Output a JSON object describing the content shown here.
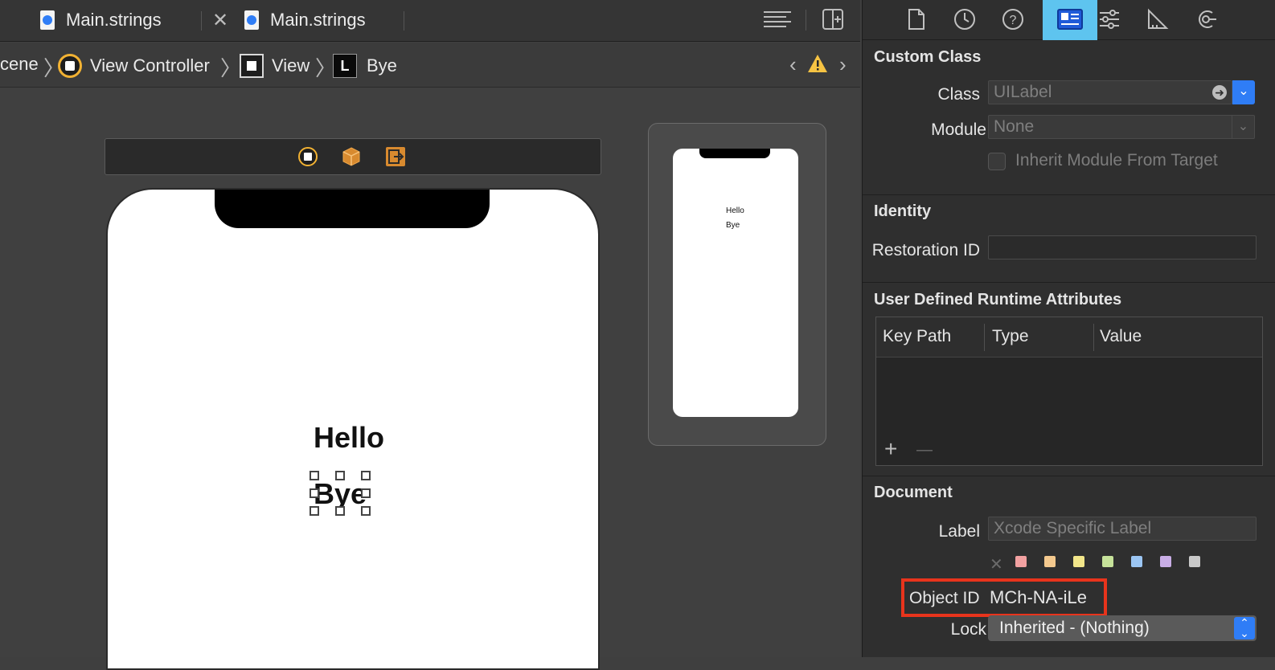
{
  "tabs": [
    {
      "label": "Main.strings",
      "close": ""
    },
    {
      "label": "Main.strings",
      "close": "✕"
    }
  ],
  "breadcrumb": {
    "items": [
      "cene",
      "View Controller",
      "View",
      "Bye"
    ],
    "badge_label": "L"
  },
  "canvas": {
    "labels": [
      "Hello",
      "Bye"
    ],
    "mini_labels": [
      "Hello",
      "Bye"
    ]
  },
  "inspector": {
    "custom_class": {
      "title": "Custom Class",
      "class_label": "Class",
      "class_placeholder": "UILabel",
      "module_label": "Module",
      "module_placeholder": "None",
      "inherit_label": "Inherit Module From Target"
    },
    "identity": {
      "title": "Identity",
      "restoration_label": "Restoration ID",
      "restoration_value": ""
    },
    "runtime_attrs": {
      "title": "User Defined Runtime Attributes",
      "columns": [
        "Key Path",
        "Type",
        "Value"
      ],
      "add": "+",
      "remove": "—"
    },
    "document": {
      "title": "Document",
      "label_label": "Label",
      "label_placeholder": "Xcode Specific Label",
      "clear": "✕",
      "swatches": [
        "#f2a1a1",
        "#f4c98e",
        "#f2e68a",
        "#c6e29a",
        "#9cc6f4",
        "#c9aee6",
        "#c9c9c9"
      ],
      "object_id_label": "Object ID",
      "object_id_value": "MCh-NA-iLe",
      "lock_label": "Lock",
      "lock_value": "Inherited - (Nothing)"
    }
  },
  "colors": {
    "accent": "#2f7df6",
    "selected_tab_bg": "#5ec4ef",
    "highlight_red": "#e8341c",
    "warning": "#f6c343"
  }
}
